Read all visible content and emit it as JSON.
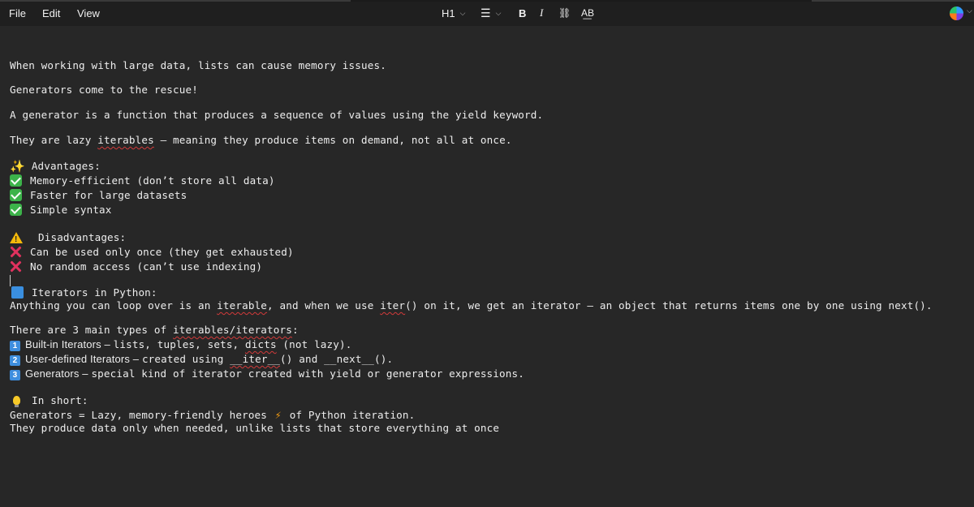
{
  "menu": {
    "file": "File",
    "edit": "Edit",
    "view": "View"
  },
  "toolbar": {
    "heading_label": "H1",
    "list_glyph": "☰",
    "bold_label": "B",
    "italic_label": "I",
    "link_glyph": "⛓",
    "spellcheck_label": "A͟B",
    "chevron": "⌵"
  },
  "document": {
    "p1": "When working with large data, lists can cause memory issues.",
    "p2": "Generators come to the rescue!",
    "p3": "A generator is a function that produces a sequence of values using the yield keyword.",
    "p4_a": "They are lazy ",
    "p4_b": "iterables",
    "p4_c": " — meaning they produce items on demand, not all at once.",
    "advantages_title": "Advantages:",
    "adv1": "Memory-efficient (don’t store all data)",
    "adv2": "Faster for large datasets",
    "adv3": "Simple syntax",
    "disadvantages_title": "Disadvantages:",
    "dis1": "Can be used only once (they get exhausted)",
    "dis2": "No random access (can’t use indexing)",
    "iter_title": "Iterators in Python:",
    "iter_a": "Anything you can loop over is an ",
    "iter_b": "iterable",
    "iter_c": ", and when we use ",
    "iter_d": "iter",
    "iter_e": "() on it, we get an iterator — an object that returns items one by one using next().",
    "types_a": "There are 3 main types of ",
    "types_b": "iterables/iterators",
    "types_c": ":",
    "type1_n": "1",
    "type1_label": "Built-in Iterators – ",
    "type1_text_a": "lists, tuples, sets, ",
    "type1_text_b": "dicts",
    "type1_text_c": " (not lazy).",
    "type2_n": "2",
    "type2_label": "User-defined Iterators – ",
    "type2_text_a": "created using ",
    "type2_text_b": "__iter__",
    "type2_text_c": "() and __next__().",
    "type3_n": "3",
    "type3_label": "Generators – ",
    "type3_text": "special kind of iterator created with yield or generator expressions.",
    "short_title": "In short:",
    "short1_a": "Generators = Lazy, memory-friendly heroes ",
    "short1_b": "of Python iteration.",
    "short2": "They produce data only when needed, unlike lists that store everything at once"
  },
  "icons": {
    "sparkle": "sparkles-icon",
    "check": "check-mark-icon",
    "warning": "warning-icon",
    "cross": "cross-mark-icon",
    "blue_square": "blue-square-icon",
    "number": "keycap-number-icon",
    "bulb": "light-bulb-icon",
    "bolt": "lightning-icon"
  },
  "colors": {
    "background": "#272727",
    "toolbar": "#1f1f1f",
    "spell_error": "#d23a3a"
  }
}
